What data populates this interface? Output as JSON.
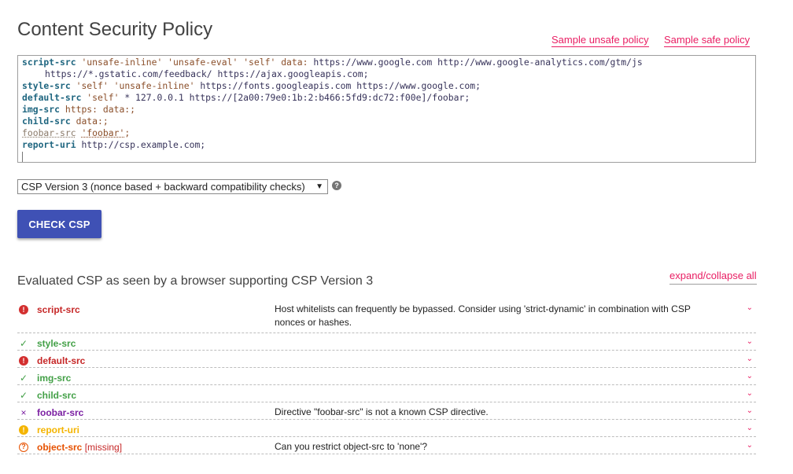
{
  "title": "Content Security Policy",
  "links": {
    "sample_unsafe": "Sample unsafe policy",
    "sample_safe": "Sample safe policy",
    "expand_collapse": "expand/collapse all"
  },
  "editor": {
    "lines": [
      [
        {
          "t": "script-src",
          "c": "kw"
        },
        {
          "t": " ",
          "c": ""
        },
        {
          "t": "'unsafe-inline'",
          "c": "val-keyword"
        },
        {
          "t": " ",
          "c": ""
        },
        {
          "t": "'unsafe-eval'",
          "c": "val-keyword"
        },
        {
          "t": " ",
          "c": ""
        },
        {
          "t": "'self'",
          "c": "val-keyword"
        },
        {
          "t": " ",
          "c": ""
        },
        {
          "t": "data:",
          "c": "val-keyword"
        },
        {
          "t": " ",
          "c": ""
        },
        {
          "t": "https://www.google.com",
          "c": "url"
        },
        {
          "t": " ",
          "c": ""
        },
        {
          "t": "http://www.google-analytics.com/gtm/js",
          "c": "url"
        }
      ],
      [
        {
          "t": "https://*.gstatic.com/feedback/",
          "c": "url"
        },
        {
          "t": " ",
          "c": ""
        },
        {
          "t": "https://ajax.googleapis.com;",
          "c": "url"
        }
      ],
      [
        {
          "t": "style-src",
          "c": "kw"
        },
        {
          "t": " ",
          "c": ""
        },
        {
          "t": "'self'",
          "c": "val-keyword"
        },
        {
          "t": " ",
          "c": ""
        },
        {
          "t": "'unsafe-inline'",
          "c": "val-keyword"
        },
        {
          "t": " ",
          "c": ""
        },
        {
          "t": "https://fonts.googleapis.com",
          "c": "url"
        },
        {
          "t": " ",
          "c": ""
        },
        {
          "t": "https://www.google.com;",
          "c": "url"
        }
      ],
      [
        {
          "t": "default-src",
          "c": "kw"
        },
        {
          "t": " ",
          "c": ""
        },
        {
          "t": "'self'",
          "c": "val-keyword"
        },
        {
          "t": " ",
          "c": ""
        },
        {
          "t": "* 127.0.0.1",
          "c": "url"
        },
        {
          "t": " ",
          "c": ""
        },
        {
          "t": "https://[2a00:79e0:1b:2:b466:5fd9:dc72:f00e]/foobar;",
          "c": "url"
        }
      ],
      [
        {
          "t": "img-src",
          "c": "kw"
        },
        {
          "t": " ",
          "c": ""
        },
        {
          "t": "https: data:;",
          "c": "val-keyword"
        }
      ],
      [
        {
          "t": "child-src",
          "c": "kw"
        },
        {
          "t": " ",
          "c": ""
        },
        {
          "t": "data:;",
          "c": "val-keyword"
        }
      ],
      [
        {
          "t": "foobar-src",
          "c": "kw-unknown"
        },
        {
          "t": " ",
          "c": ""
        },
        {
          "t": "'foobar'",
          "c": "val-unknown"
        },
        {
          "t": ";",
          "c": "val-keyword"
        }
      ],
      [
        {
          "t": "report-uri",
          "c": "kw"
        },
        {
          "t": " ",
          "c": ""
        },
        {
          "t": "http://csp.example.com;",
          "c": "url"
        }
      ]
    ]
  },
  "version_select": {
    "selected": "CSP Version 3 (nonce based + backward compatibility checks)"
  },
  "check_button": "CHECK CSP",
  "eval_heading": "Evaluated CSP as seen by a browser supporting CSP Version 3",
  "results": [
    {
      "directive": "script-src",
      "status": "high",
      "missing": "",
      "desc": "Host whitelists can frequently be bypassed. Consider using 'strict-dynamic' in combination with CSP nonces or hashes."
    },
    {
      "directive": "style-src",
      "status": "ok",
      "missing": "",
      "desc": ""
    },
    {
      "directive": "default-src",
      "status": "high",
      "missing": "",
      "desc": ""
    },
    {
      "directive": "img-src",
      "status": "ok",
      "missing": "",
      "desc": ""
    },
    {
      "directive": "child-src",
      "status": "ok",
      "missing": "",
      "desc": ""
    },
    {
      "directive": "foobar-src",
      "status": "syntax",
      "missing": "",
      "desc": "Directive \"foobar-src\" is not a known CSP directive."
    },
    {
      "directive": "report-uri",
      "status": "medium",
      "missing": "",
      "desc": ""
    },
    {
      "directive": "object-src",
      "status": "possible",
      "missing": "[missing]",
      "desc": "Can you restrict object-src to 'none'?"
    }
  ],
  "status_colors": {
    "high": "#d32f2f",
    "ok": "#43a047",
    "syntax": "#7b1fa2",
    "medium": "#f4b400",
    "possible": "#e65100",
    "link": "#e91e63",
    "button": "#3f51b5"
  }
}
